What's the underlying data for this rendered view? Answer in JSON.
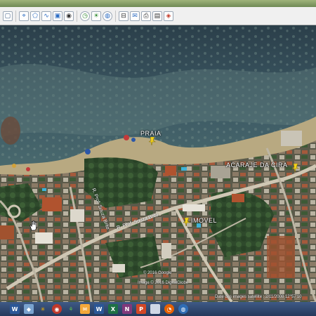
{
  "map": {
    "labels": {
      "praia": "PRAIA",
      "acaraje": "ACARAJE DA CIRA",
      "imovel": "IMOVEL"
    },
    "streets": {
      "main": "R. Prof. Souza Brito",
      "side": "R. Prof. Souza Brito",
      "right": "R. ..."
    },
    "attribution": {
      "copyright": "© 2016 Google",
      "image": "Image © 2016 DigitalGlobe",
      "date": "Date des images satellite : 2/11/2008    12°57'10"
    }
  },
  "toolbar": {
    "icons": [
      "arrow-icon",
      "doc-icon",
      "pencil-icon",
      "polygon-icon",
      "path-icon",
      "overlay-icon",
      "tour-icon",
      "globe-icon",
      "earth-icon",
      "sky-icon",
      "ruler-icon",
      "email-icon",
      "print-icon",
      "save-image-icon",
      "maps-icon"
    ]
  },
  "taskbar": {
    "apps": [
      "word",
      "paint",
      "tools",
      "media",
      "explorer",
      "outlook",
      "word2",
      "excel",
      "onenote",
      "powerpoint",
      "blank",
      "firefox",
      "google-earth"
    ]
  }
}
